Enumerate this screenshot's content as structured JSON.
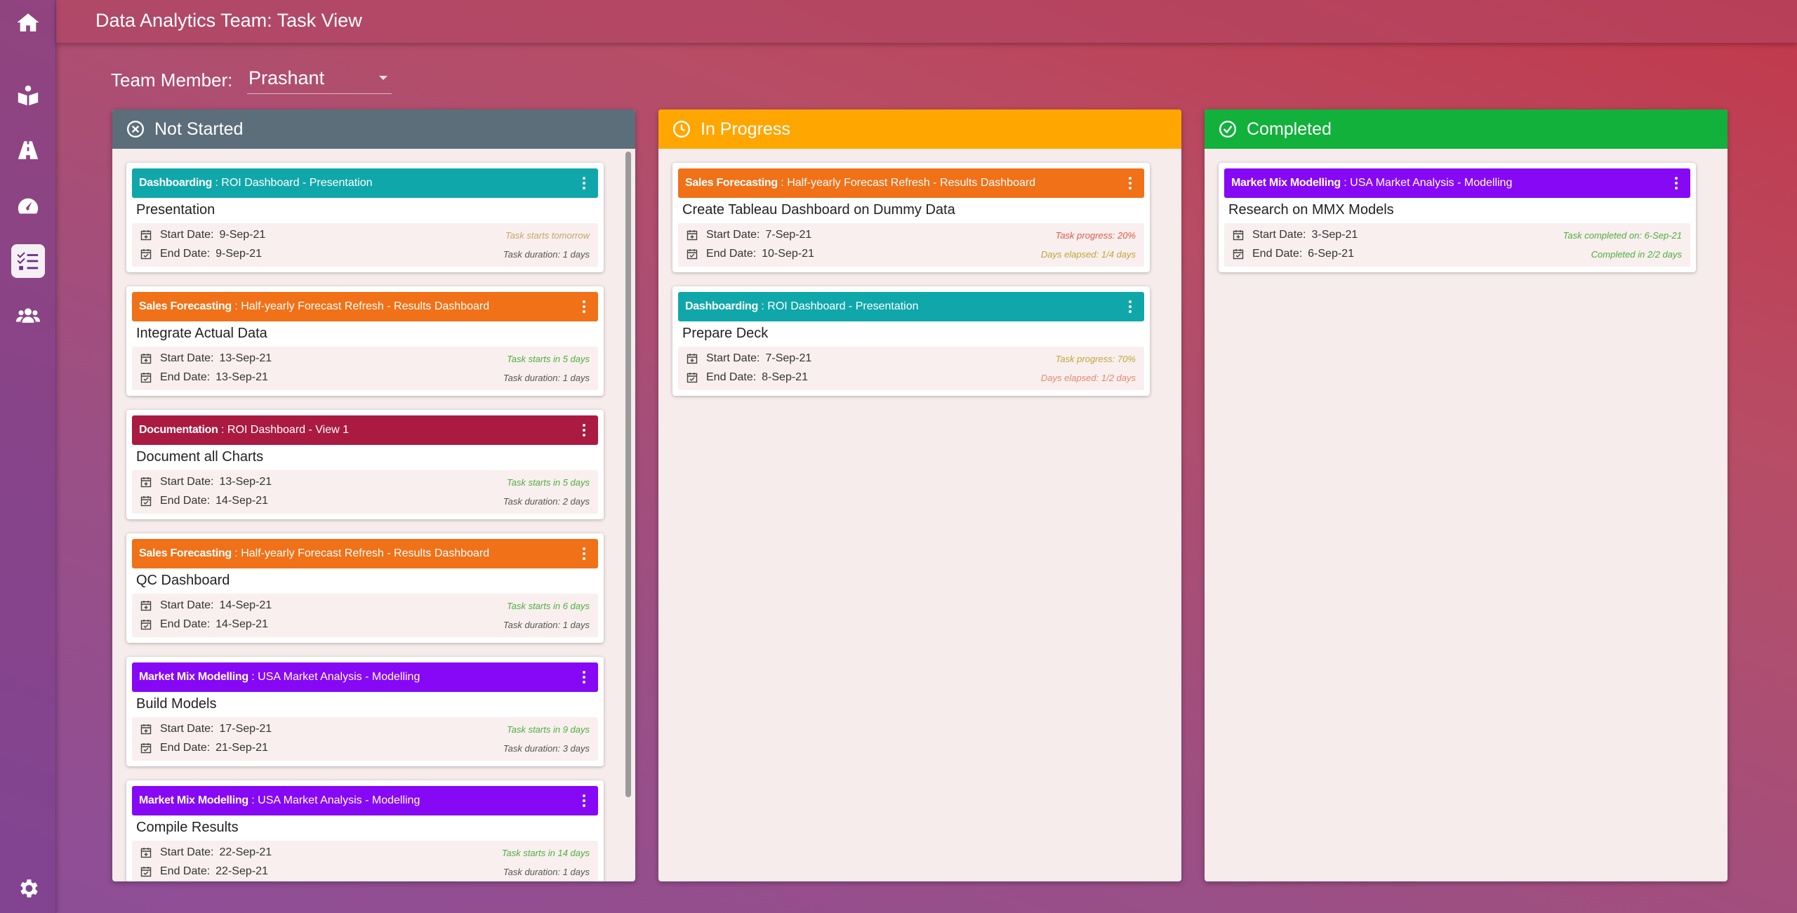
{
  "app": {
    "title": "Data Analytics Team: Task View"
  },
  "filter": {
    "label": "Team Member:",
    "selected": "Prashant"
  },
  "sidebar": {
    "items": [
      {
        "icon": "home-icon"
      },
      {
        "icon": "book-reader-icon"
      },
      {
        "icon": "road-icon"
      },
      {
        "icon": "tachometer-icon"
      },
      {
        "icon": "tasks-icon",
        "active": true
      },
      {
        "icon": "users-icon"
      },
      {
        "icon": "gear-icon"
      }
    ]
  },
  "columns": [
    {
      "title": "Not Started",
      "color": "#5b6e7a",
      "icon": "times-circle-icon",
      "cards": [
        {
          "project": "Dashboarding",
          "sub": " : ROI Dashboard - Presentation",
          "color": "#10a7aa",
          "title": "Presentation",
          "start_label": "Start Date:",
          "start": "9-Sep-21",
          "end_label": "End Date:",
          "end": "9-Sep-21",
          "note1": "Task starts tomorrow",
          "note1_style": "tan",
          "note2": "Task duration: 1 days",
          "note2_style": "dark"
        },
        {
          "project": "Sales Forecasting",
          "sub": " : Half-yearly Forecast Refresh - Results Dashboard",
          "color": "#f07117",
          "title": "Integrate Actual Data",
          "start_label": "Start Date:",
          "start": "13-Sep-21",
          "end_label": "End Date:",
          "end": "13-Sep-21",
          "note1": "Task starts in 5 days",
          "note1_style": "green",
          "note2": "Task duration: 1 days",
          "note2_style": "dark"
        },
        {
          "project": "Documentation",
          "sub": " : ROI Dashboard - View 1",
          "color": "#aa1a41",
          "title": "Document all Charts",
          "start_label": "Start Date:",
          "start": "13-Sep-21",
          "end_label": "End Date:",
          "end": "14-Sep-21",
          "note1": "Task starts in 5 days",
          "note1_style": "green",
          "note2": "Task duration: 2 days",
          "note2_style": "dark"
        },
        {
          "project": "Sales Forecasting",
          "sub": " : Half-yearly Forecast Refresh - Results Dashboard",
          "color": "#f07117",
          "title": "QC Dashboard",
          "start_label": "Start Date:",
          "start": "14-Sep-21",
          "end_label": "End Date:",
          "end": "14-Sep-21",
          "note1": "Task starts in 6 days",
          "note1_style": "green",
          "note2": "Task duration: 1 days",
          "note2_style": "dark"
        },
        {
          "project": "Market Mix Modelling",
          "sub": " : USA Market Analysis - Modelling",
          "color": "#8608f5",
          "title": "Build Models",
          "start_label": "Start Date:",
          "start": "17-Sep-21",
          "end_label": "End Date:",
          "end": "21-Sep-21",
          "note1": "Task starts in 9 days",
          "note1_style": "green",
          "note2": "Task duration: 3 days",
          "note2_style": "dark"
        },
        {
          "project": "Market Mix Modelling",
          "sub": " : USA Market Analysis - Modelling",
          "color": "#8608f5",
          "title": "Compile Results",
          "start_label": "Start Date:",
          "start": "22-Sep-21",
          "end_label": "End Date:",
          "end": "22-Sep-21",
          "note1": "Task starts in 14 days",
          "note1_style": "green",
          "note2": "Task duration: 1 days",
          "note2_style": "dark"
        }
      ]
    },
    {
      "title": "In Progress",
      "color": "#ffa600",
      "icon": "clock-icon",
      "cards": [
        {
          "project": "Sales Forecasting",
          "sub": " : Half-yearly Forecast Refresh - Results Dashboard",
          "color": "#f07117",
          "title": "Create Tableau Dashboard on Dummy Data",
          "start_label": "Start Date:",
          "start": "7-Sep-21",
          "end_label": "End Date:",
          "end": "10-Sep-21",
          "note1": "Task progress: 20%",
          "note1_style": "red",
          "note2": "Days elapsed: 1/4 days",
          "note2_style": "yellow"
        },
        {
          "project": "Dashboarding",
          "sub": " : ROI Dashboard - Presentation",
          "color": "#10a7aa",
          "title": "Prepare Deck",
          "start_label": "Start Date:",
          "start": "7-Sep-21",
          "end_label": "End Date:",
          "end": "8-Sep-21",
          "note1": "Task progress: 70%",
          "note1_style": "yellow",
          "note2": "Days elapsed: 1/2 days",
          "note2_style": "salmon"
        }
      ]
    },
    {
      "title": "Completed",
      "color": "#11b13b",
      "icon": "check-circle-icon",
      "cards": [
        {
          "project": "Market Mix Modelling",
          "sub": " : USA Market Analysis - Modelling",
          "color": "#8608f5",
          "title": "Research on MMX Models",
          "start_label": "Start Date:",
          "start": "3-Sep-21",
          "end_label": "End Date:",
          "end": "6-Sep-21",
          "note1": "Task completed on: 6-Sep-21",
          "note1_style": "green",
          "note2": "Completed in 2/2 days",
          "note2_style": "green"
        }
      ]
    }
  ]
}
